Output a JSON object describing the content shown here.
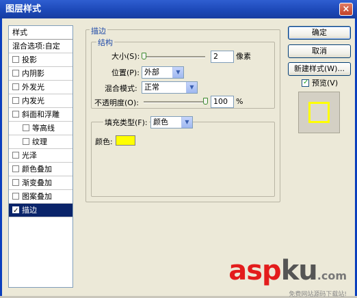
{
  "window": {
    "title": "图层样式",
    "close_label": "×"
  },
  "list": {
    "items": [
      {
        "label": "样式",
        "checkbox": false,
        "checked": false,
        "selected": false
      },
      {
        "label": "混合选项:自定",
        "checkbox": false,
        "checked": false,
        "selected": false
      },
      {
        "label": "投影",
        "checkbox": true,
        "checked": false,
        "selected": false
      },
      {
        "label": "内阴影",
        "checkbox": true,
        "checked": false,
        "selected": false
      },
      {
        "label": "外发光",
        "checkbox": true,
        "checked": false,
        "selected": false
      },
      {
        "label": "内发光",
        "checkbox": true,
        "checked": false,
        "selected": false
      },
      {
        "label": "斜面和浮雕",
        "checkbox": true,
        "checked": false,
        "selected": false
      },
      {
        "label": "等高线",
        "checkbox": true,
        "checked": false,
        "selected": false,
        "sub": true
      },
      {
        "label": "纹理",
        "checkbox": true,
        "checked": false,
        "selected": false,
        "sub": true
      },
      {
        "label": "光泽",
        "checkbox": true,
        "checked": false,
        "selected": false
      },
      {
        "label": "颜色叠加",
        "checkbox": true,
        "checked": false,
        "selected": false
      },
      {
        "label": "渐变叠加",
        "checkbox": true,
        "checked": false,
        "selected": false
      },
      {
        "label": "图案叠加",
        "checkbox": true,
        "checked": false,
        "selected": false
      },
      {
        "label": "描边",
        "checkbox": true,
        "checked": true,
        "selected": true
      }
    ]
  },
  "stroke": {
    "title": "描边",
    "structure": {
      "title": "结构",
      "size_label": "大小(S):",
      "size_value": "2",
      "size_unit": "像素",
      "position_label": "位置(P):",
      "position_value": "外部",
      "blend_label": "混合模式:",
      "blend_value": "正常",
      "opacity_label": "不透明度(O):",
      "opacity_value": "100",
      "opacity_unit": "%",
      "opacity_fraction": 1.0
    },
    "fill": {
      "type_label": "填充类型(F):",
      "type_value": "颜色",
      "color_label": "颜色:",
      "color": "#ffff00"
    }
  },
  "buttons": {
    "ok": "确定",
    "cancel": "取消",
    "new_style": "新建样式(W)...",
    "preview": "预览(V)",
    "preview_checked": true
  },
  "watermark": {
    "brand_a": "asp",
    "brand_b": "ku",
    "brand_c": ".com",
    "tagline": "免费网站源码下载站!"
  }
}
